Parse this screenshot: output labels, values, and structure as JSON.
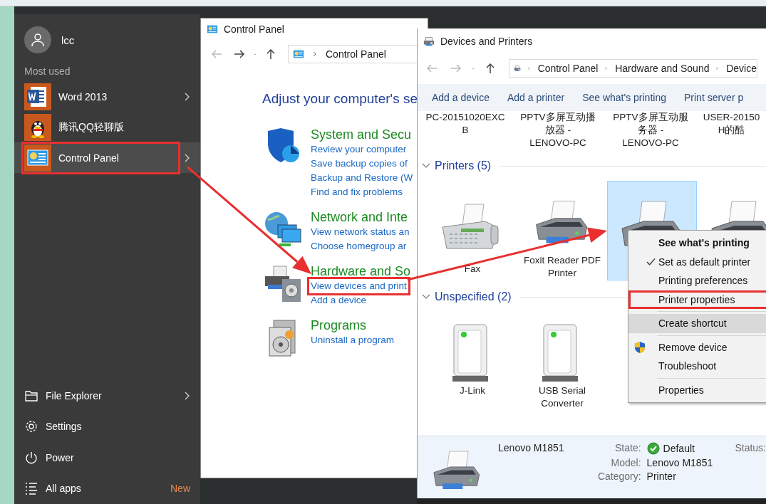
{
  "start_menu": {
    "user": "lcc",
    "section_title": "Most used",
    "apps": [
      {
        "kind": "word",
        "label": "Word 2013",
        "has_submenu": true,
        "hovered": false,
        "annotated": false
      },
      {
        "kind": "qq",
        "label": "腾讯QQ轻聊版",
        "has_submenu": false,
        "hovered": false,
        "annotated": false
      },
      {
        "kind": "control-panel",
        "label": "Control Panel",
        "has_submenu": true,
        "hovered": true,
        "annotated": true
      }
    ],
    "bottom": [
      {
        "kind": "folder",
        "label": "File Explorer",
        "has_submenu": true
      },
      {
        "kind": "gear",
        "label": "Settings",
        "has_submenu": false
      },
      {
        "kind": "power",
        "label": "Power",
        "has_submenu": false
      },
      {
        "kind": "list",
        "label": "All apps",
        "has_submenu": false,
        "badge": "New"
      }
    ]
  },
  "control_panel": {
    "title": "Control Panel",
    "address": [
      "Control Panel"
    ],
    "heading": "Adjust your computer's se",
    "categories": [
      {
        "kind": "shield",
        "title": "System and Secu",
        "links": [
          {
            "text": "Review your computer",
            "annotated": false
          },
          {
            "text": "Save backup copies of",
            "annotated": false
          },
          {
            "text": "Backup and Restore (W",
            "annotated": false
          },
          {
            "text": "Find and fix problems",
            "annotated": false
          }
        ]
      },
      {
        "kind": "network",
        "title": "Network and Inte",
        "links": [
          {
            "text": "View network status an",
            "annotated": false
          },
          {
            "text": "Choose homegroup ar",
            "annotated": false
          }
        ]
      },
      {
        "kind": "hardware",
        "title": "Hardware and So",
        "links": [
          {
            "text": "View devices and print",
            "annotated": true
          },
          {
            "text": "Add a device",
            "annotated": false
          }
        ]
      },
      {
        "kind": "programs",
        "title": "Programs",
        "links": [
          {
            "text": "Uninstall a program",
            "annotated": false
          }
        ]
      }
    ]
  },
  "devices": {
    "title": "Devices and Printers",
    "address": [
      "Control Panel",
      "Hardware and Sound",
      "Device"
    ],
    "toolbar": [
      "Add a device",
      "Add a printer",
      "See what's printing",
      "Print server p"
    ],
    "network_devices": [
      {
        "lines": [
          "PC-20151020EXC",
          "B"
        ]
      },
      {
        "lines": [
          "PPTV多屏互动播",
          "放器 -",
          "LENOVO-PC"
        ]
      },
      {
        "lines": [
          "PPTV多屏互动服",
          "务器 -",
          "LENOVO-PC"
        ]
      },
      {
        "lines": [
          "USER-20150",
          "H的酷"
        ]
      }
    ],
    "groups": [
      {
        "title": "Printers (5)",
        "expanded": true,
        "items": [
          {
            "kind": "fax",
            "lines": [
              "Fax"
            ],
            "selected": false
          },
          {
            "kind": "printer",
            "lines": [
              "Foxit Reader PDF",
              "Printer"
            ],
            "selected": false
          },
          {
            "kind": "printer",
            "selected": true
          },
          {
            "kind": "printer",
            "selected": false
          }
        ]
      },
      {
        "title": "Unspecified (2)",
        "expanded": true,
        "items": [
          {
            "kind": "box",
            "lines": [
              "J-Link"
            ],
            "selected": false
          },
          {
            "kind": "box",
            "lines": [
              "USB Serial",
              "Converter"
            ],
            "selected": false
          }
        ]
      }
    ],
    "details": {
      "name": "Lenovo M1851",
      "fields": [
        {
          "label": "State:",
          "value": "Default",
          "ok": true
        },
        {
          "label": "Model:",
          "value": "Lenovo M1851",
          "ok": false
        },
        {
          "label": "Category:",
          "value": "Printer",
          "ok": false
        }
      ],
      "extra_label": "Status:"
    }
  },
  "context_menu": [
    {
      "kind": "item",
      "label": "See what's printing",
      "bold": true,
      "checked": false,
      "shield": false,
      "hovered": false,
      "annotated": false
    },
    {
      "kind": "item",
      "label": "Set as default printer",
      "bold": false,
      "checked": true,
      "shield": false,
      "hovered": false,
      "annotated": false
    },
    {
      "kind": "item",
      "label": "Printing preferences",
      "bold": false,
      "checked": false,
      "shield": false,
      "hovered": false,
      "annotated": false
    },
    {
      "kind": "item",
      "label": "Printer properties",
      "bold": false,
      "checked": false,
      "shield": false,
      "hovered": false,
      "annotated": true
    },
    {
      "kind": "separator"
    },
    {
      "kind": "item",
      "label": "Create shortcut",
      "bold": false,
      "checked": false,
      "shield": false,
      "hovered": true,
      "annotated": false
    },
    {
      "kind": "separator"
    },
    {
      "kind": "item",
      "label": "Remove device",
      "bold": false,
      "checked": false,
      "shield": true,
      "hovered": false,
      "annotated": false
    },
    {
      "kind": "item",
      "label": "Troubleshoot",
      "bold": false,
      "checked": false,
      "shield": false,
      "hovered": false,
      "annotated": false
    },
    {
      "kind": "separator"
    },
    {
      "kind": "item",
      "label": "Properties",
      "bold": false,
      "checked": false,
      "shield": false,
      "hovered": false,
      "annotated": false
    }
  ],
  "annotation_arrows": true
}
